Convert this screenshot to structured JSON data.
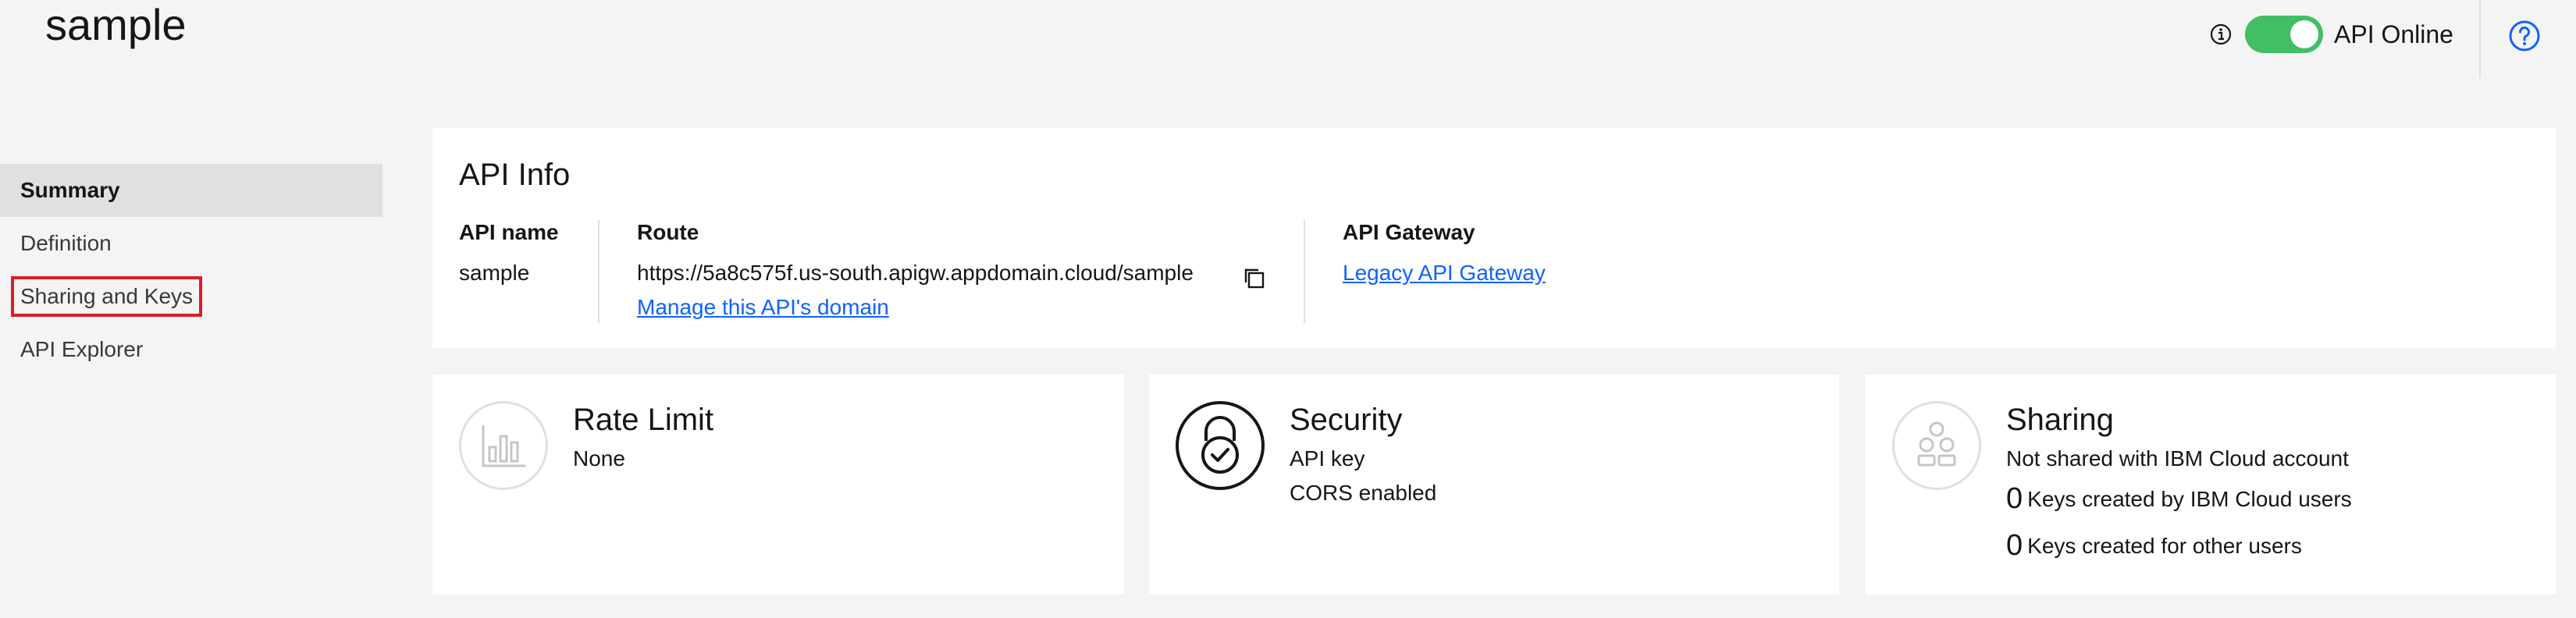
{
  "app": {
    "title": "sample"
  },
  "header": {
    "api_status": "API Online",
    "api_online": true
  },
  "sidebar": {
    "items": [
      {
        "label": "Summary",
        "active": true
      },
      {
        "label": "Definition"
      },
      {
        "label": "Sharing and Keys",
        "highlighted": true
      },
      {
        "label": "API Explorer"
      }
    ]
  },
  "api_info": {
    "title": "API Info",
    "api_name_label": "API name",
    "api_name": "sample",
    "route_label": "Route",
    "route": "https://5a8c575f.us-south.apigw.appdomain.cloud/sample",
    "manage_domain_link": "Manage this API's domain",
    "gateway_label": "API Gateway",
    "gateway_link": "Legacy API Gateway"
  },
  "rate_limit": {
    "title": "Rate Limit",
    "value": "None"
  },
  "security": {
    "title": "Security",
    "line1": "API key",
    "line2": "CORS enabled"
  },
  "sharing": {
    "title": "Sharing",
    "line1": "Not shared with IBM Cloud account",
    "ibm_keys_count": "0",
    "ibm_keys_label": "Keys created by IBM Cloud users",
    "other_keys_count": "0",
    "other_keys_label": "Keys created for other users"
  },
  "colors": {
    "toggle_on": "#42be65",
    "link": "#0f62fe",
    "highlight": "#da1e28"
  },
  "icons": [
    "info-icon",
    "help-icon",
    "copy-icon",
    "bar-chart-icon",
    "lock-icon",
    "users-icon"
  ]
}
